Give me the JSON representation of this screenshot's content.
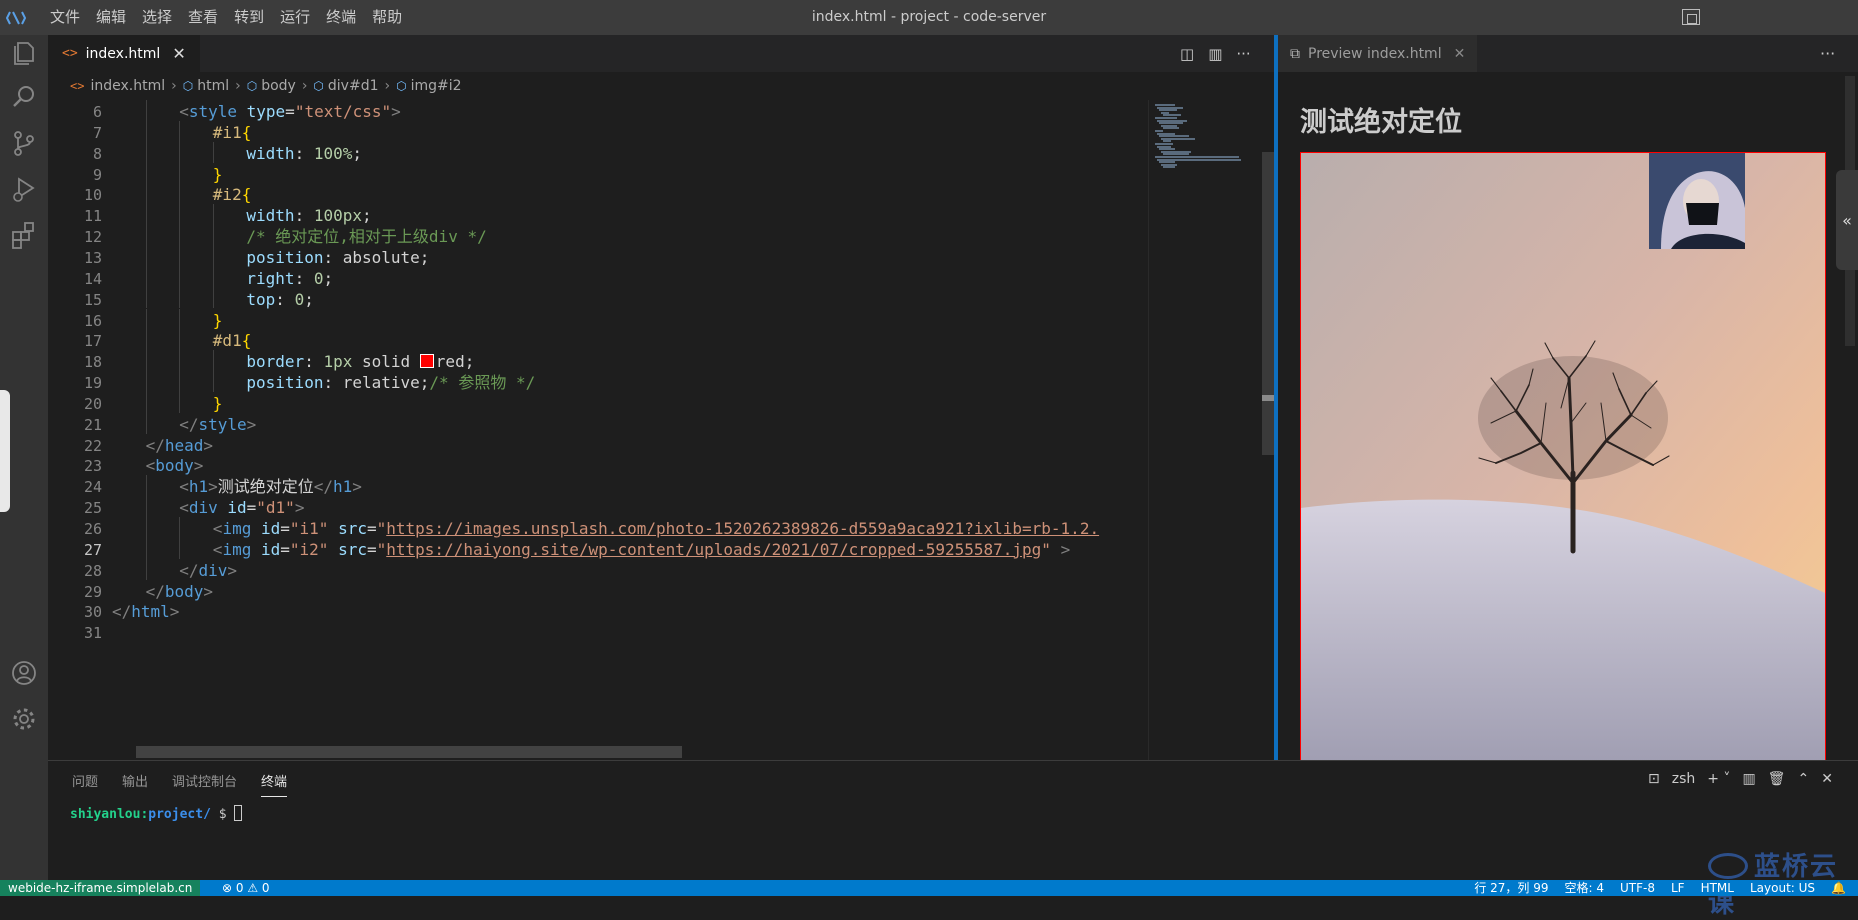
{
  "titlebar": {
    "menu": [
      "文件",
      "编辑",
      "选择",
      "查看",
      "转到",
      "运行",
      "终端",
      "帮助"
    ],
    "title": "index.html - project - code-server"
  },
  "activity_icons": [
    "explorer-icon",
    "search-icon",
    "source-control-icon",
    "run-debug-icon",
    "extensions-icon",
    "account-icon",
    "settings-gear-icon"
  ],
  "editor": {
    "tab_label": "index.html",
    "breadcrumb": [
      "index.html",
      "html",
      "body",
      "div#d1",
      "img#i2"
    ],
    "lines": [
      {
        "n": "6",
        "html": "<span class='br'>&lt;</span><span class='tag'>style</span> <span class='attr'>type</span><span class='plain'>=</span><span class='str'>\"text/css\"</span><span class='br'>&gt;</span>",
        "indent": 2
      },
      {
        "n": "7",
        "html": "<span class='sel'>#i1</span><span class='brc'>{</span>",
        "indent": 3
      },
      {
        "n": "8",
        "html": "<span class='prop'>width</span><span class='plain'>: </span><span class='num'>100%</span><span class='plain'>;</span>",
        "indent": 4
      },
      {
        "n": "9",
        "html": "<span class='brc'>}</span>",
        "indent": 3
      },
      {
        "n": "10",
        "html": "<span class='sel'>#i2</span><span class='brc'>{</span>",
        "indent": 3
      },
      {
        "n": "11",
        "html": "<span class='prop'>width</span><span class='plain'>: </span><span class='num'>100px</span><span class='plain'>;</span>",
        "indent": 4
      },
      {
        "n": "12",
        "html": "<span class='cmt'>/* 绝对定位,相对于上级div */</span>",
        "indent": 4
      },
      {
        "n": "13",
        "html": "<span class='prop'>position</span><span class='plain'>: absolute;</span>",
        "indent": 4
      },
      {
        "n": "14",
        "html": "<span class='prop'>right</span><span class='plain'>: </span><span class='num'>0</span><span class='plain'>;</span>",
        "indent": 4
      },
      {
        "n": "15",
        "html": "<span class='prop'>top</span><span class='plain'>: </span><span class='num'>0</span><span class='plain'>;</span>",
        "indent": 4
      },
      {
        "n": "16",
        "html": "<span class='brc'>}</span>",
        "indent": 3
      },
      {
        "n": "17",
        "html": "<span class='sel'>#d1</span><span class='brc'>{</span>",
        "indent": 3
      },
      {
        "n": "18",
        "html": "<span class='prop'>border</span><span class='plain'>: </span><span class='num'>1px</span><span class='plain'> solid </span><span class='swatch'></span><span class='plain'>red;</span>",
        "indent": 4
      },
      {
        "n": "19",
        "html": "<span class='prop'>position</span><span class='plain'>: relative;</span><span class='cmt'>/* 参照物 */</span>",
        "indent": 4
      },
      {
        "n": "20",
        "html": "<span class='brc'>}</span>",
        "indent": 3
      },
      {
        "n": "21",
        "html": "<span class='br'>&lt;/</span><span class='tag'>style</span><span class='br'>&gt;</span>",
        "indent": 2
      },
      {
        "n": "22",
        "html": "<span class='br'>&lt;/</span><span class='tag'>head</span><span class='br'>&gt;</span>",
        "indent": 1
      },
      {
        "n": "23",
        "html": "<span class='br'>&lt;</span><span class='tag'>body</span><span class='br'>&gt;</span>",
        "indent": 1
      },
      {
        "n": "24",
        "html": "<span class='br'>&lt;</span><span class='tag'>h1</span><span class='br'>&gt;</span><span class='txt'>测试绝对定位</span><span class='br'>&lt;/</span><span class='tag'>h1</span><span class='br'>&gt;</span>",
        "indent": 2
      },
      {
        "n": "25",
        "html": "<span class='br'>&lt;</span><span class='tag'>div</span> <span class='attr'>id</span><span class='plain'>=</span><span class='str'>\"d1\"</span><span class='br'>&gt;</span>",
        "indent": 2
      },
      {
        "n": "26",
        "html": "<span class='br'>&lt;</span><span class='tag'>img</span> <span class='attr'>id</span><span class='plain'>=</span><span class='str'>\"i1\"</span> <span class='attr'>src</span><span class='plain'>=</span><span class='str'>\"</span><span class='url'>https://images.unsplash.com/photo-1520262389826-d559a9aca921?ixlib=rb-1.2.</span>",
        "indent": 3
      },
      {
        "n": "27",
        "html": "<span class='br'>&lt;</span><span class='tag'>img</span> <span class='attr'>id</span><span class='plain'>=</span><span class='str'>\"i2\"</span> <span class='attr'>src</span><span class='plain'>=</span><span class='str'>\"</span><span class='url'>https://haiyong.site/wp-content/uploads/2021/07/cropped-59255587.jpg</span><span class='str'>\"</span> <span class='br'>&gt;</span>",
        "indent": 3,
        "active": true
      },
      {
        "n": "28",
        "html": "<span class='br'>&lt;/</span><span class='tag'>div</span><span class='br'>&gt;</span>",
        "indent": 2
      },
      {
        "n": "29",
        "html": "<span class='br'>&lt;/</span><span class='tag'>body</span><span class='br'>&gt;</span>",
        "indent": 1
      },
      {
        "n": "30",
        "html": "<span class='br'>&lt;/</span><span class='tag'>html</span><span class='br'>&gt;</span>",
        "indent": 0
      },
      {
        "n": "31",
        "html": "",
        "indent": 0
      }
    ]
  },
  "preview": {
    "tab_label": "Preview index.html",
    "heading": "测试绝对定位"
  },
  "panel": {
    "tabs": [
      "问题",
      "输出",
      "调试控制台",
      "终端"
    ],
    "active_tab": "终端",
    "shell": "zsh",
    "prompt_user": "shiyanlou:",
    "prompt_path": "project/",
    "prompt_symbol": "$",
    "watermark": "蓝桥云课"
  },
  "statusbar": {
    "remote": "webide-hz-iframe.simplelab.cn",
    "problems": "⊗ 0 ⚠ 0",
    "position": "行 27，列 99",
    "spaces": "空格: 4",
    "encoding": "UTF-8",
    "eol": "LF",
    "language": "HTML",
    "layout": "Layout: US"
  },
  "colors": {
    "accent": "#007acc",
    "remote": "#16825d",
    "border_red": "#ff0000"
  }
}
